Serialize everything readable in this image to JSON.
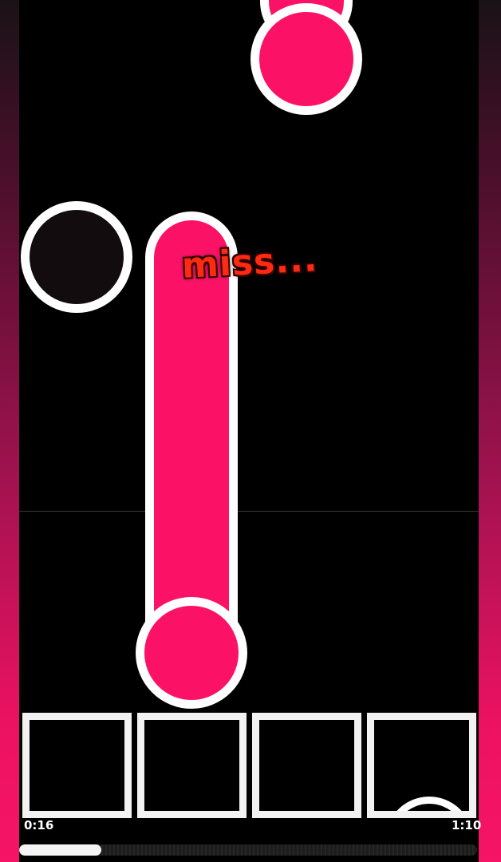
{
  "judgment": {
    "text": "miss..."
  },
  "song": {
    "elapsed": "0:16",
    "duration": "1:10",
    "progress_fraction": 0.18
  },
  "lanes": {
    "count": 4,
    "keys": [
      {
        "name": "lane-1"
      },
      {
        "name": "lane-2"
      },
      {
        "name": "lane-3"
      },
      {
        "name": "lane-4"
      }
    ]
  },
  "colors": {
    "note_accent": "#fb1267",
    "note_outline": "#ffffff",
    "missed_note_fill": "#130c0e",
    "judgment_text": "#ff2a12",
    "side_gradient_bottom": "#f51466"
  }
}
